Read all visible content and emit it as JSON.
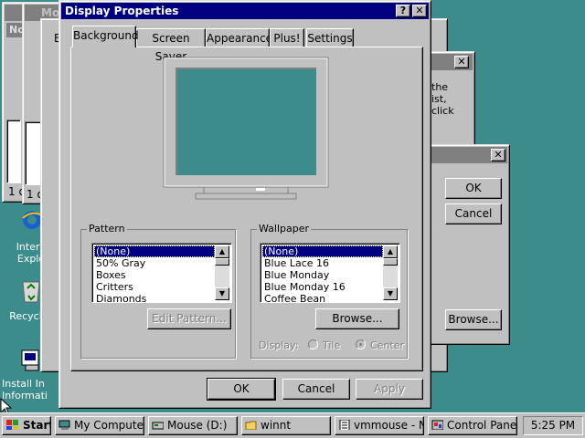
{
  "desktop": {
    "icons": [
      {
        "name": "internet-explorer",
        "label_line1": "Intern",
        "label_line2": "Explo"
      },
      {
        "name": "recycle-bin",
        "label_line1": "Recycl"
      },
      {
        "name": "install-info",
        "label_line1": "Install In",
        "label_line2": "Informati"
      }
    ]
  },
  "bg_windows": {
    "w1_title": "Mo",
    "w1_subtitle": "No Po",
    "w2_title": "Mo",
    "w1_status": "1 o",
    "w2_status": "1 o",
    "w2_tab": "B",
    "right_text1": "the",
    "right_text2": "ist,",
    "right_text3": "click",
    "right_ok": "OK",
    "right_cancel": "Cancel",
    "right_browse": "Browse..."
  },
  "dialog": {
    "title": "Display Properties",
    "help_label": "?",
    "close_label": "✕",
    "tabs": [
      "Background",
      "Screen Saver",
      "Appearance",
      "Plus!",
      "Settings"
    ],
    "pattern": {
      "label": "Pattern",
      "items": [
        "(None)",
        "50% Gray",
        "Boxes",
        "Critters",
        "Diamonds"
      ],
      "selected": 0,
      "edit_button": "Edit Pattern..."
    },
    "wallpaper": {
      "label": "Wallpaper",
      "items": [
        "(None)",
        "Blue Lace 16",
        "Blue Monday",
        "Blue Monday 16",
        "Coffee Bean"
      ],
      "selected": 0,
      "browse_button": "Browse...",
      "display_label": "Display:",
      "tile_label": "Tile",
      "center_label": "Center"
    },
    "ok": "OK",
    "cancel": "Cancel",
    "apply": "Apply",
    "preview_color": "#3c8c8c"
  },
  "taskbar": {
    "start": "Start",
    "items": [
      "My Computer",
      "Mouse (D:)",
      "winnt",
      "vmmouse - N...",
      "Control Panel"
    ],
    "clock": "5:25 PM"
  },
  "colors": {
    "desktop": "#3c8c8c",
    "active_title": "#000080",
    "face": "#c0c0c0"
  }
}
